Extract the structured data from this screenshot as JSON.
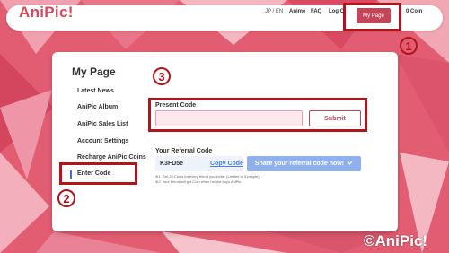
{
  "header": {
    "logo": "AniPic!",
    "nav": [
      "JP / EN",
      "Anime",
      "FAQ",
      "Log O"
    ],
    "my_page": "My Page",
    "coins": "0 Coin"
  },
  "sidebar": {
    "title": "My Page",
    "items": [
      "Latest News",
      "AniPic Album",
      "AniPic Sales List",
      "Account Settings",
      "Recharge AniPic Coins",
      "Enter Code"
    ],
    "active_index": 5
  },
  "present_code": {
    "label": "Present Code",
    "value": "",
    "submit": "Submit"
  },
  "referral": {
    "label": "Your Referral Code",
    "code": "K3FD5e",
    "copy": "Copy Code",
    "share": "Share your referral code now!",
    "notes": [
      "※1. Get 20 Coins for every friend you invite. (Limited to 5 people)",
      "※2. Your friend will get Coin when he/she buys AniPic."
    ]
  },
  "annotations": [
    "1",
    "2",
    "3"
  ],
  "watermark": "©AniPic!",
  "colors": {
    "accent": "#c44458",
    "highlight": "#b3141b",
    "link": "#4a7de0"
  }
}
